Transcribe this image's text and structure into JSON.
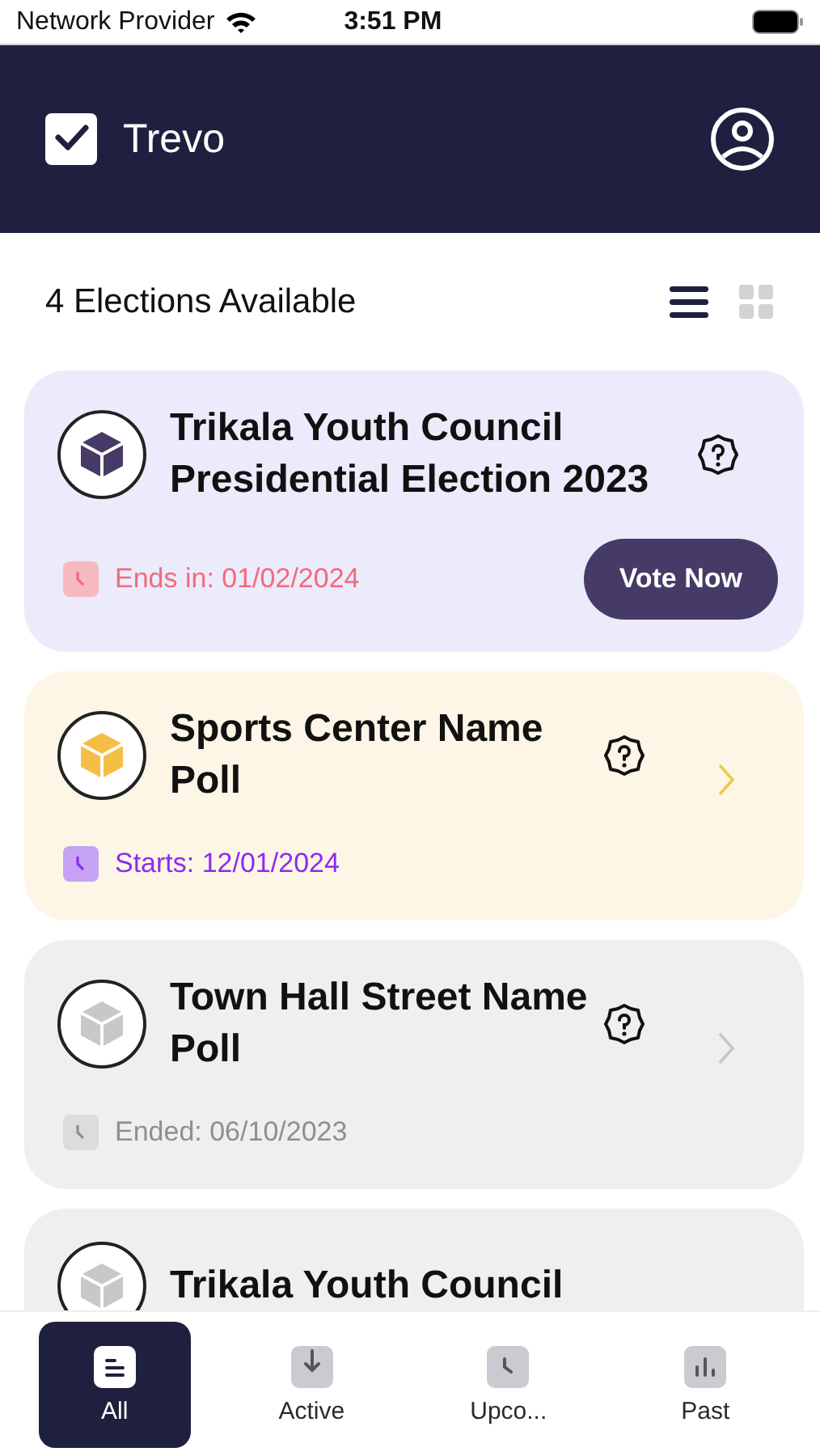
{
  "status_bar": {
    "carrier": "Network Provider",
    "time": "3:51 PM"
  },
  "header": {
    "title": "Trevo"
  },
  "toolbar": {
    "count_label": "4 Elections Available",
    "views": [
      {
        "kind": "list",
        "selected": true
      },
      {
        "kind": "grid",
        "selected": false
      }
    ]
  },
  "elections": [
    {
      "kind": "active",
      "title": "Trikala Youth Council Presidential Election 2023",
      "date": "Ends in: 01/02/2024",
      "action": "Vote Now"
    },
    {
      "kind": "upcoming",
      "title": "Sports Center Name Poll",
      "date": "Starts: 12/01/2024"
    },
    {
      "kind": "past",
      "title": "Town Hall Street Name Poll",
      "date": "Ended: 06/10/2023"
    },
    {
      "kind": "past",
      "title": "Trikala Youth Council"
    }
  ],
  "tabs": [
    {
      "label": "All",
      "kind": "list",
      "selected": true
    },
    {
      "label": "Active",
      "kind": "download",
      "selected": false
    },
    {
      "label": "Upco...",
      "kind": "clock",
      "selected": false
    },
    {
      "label": "Past",
      "kind": "chart",
      "selected": false
    }
  ]
}
